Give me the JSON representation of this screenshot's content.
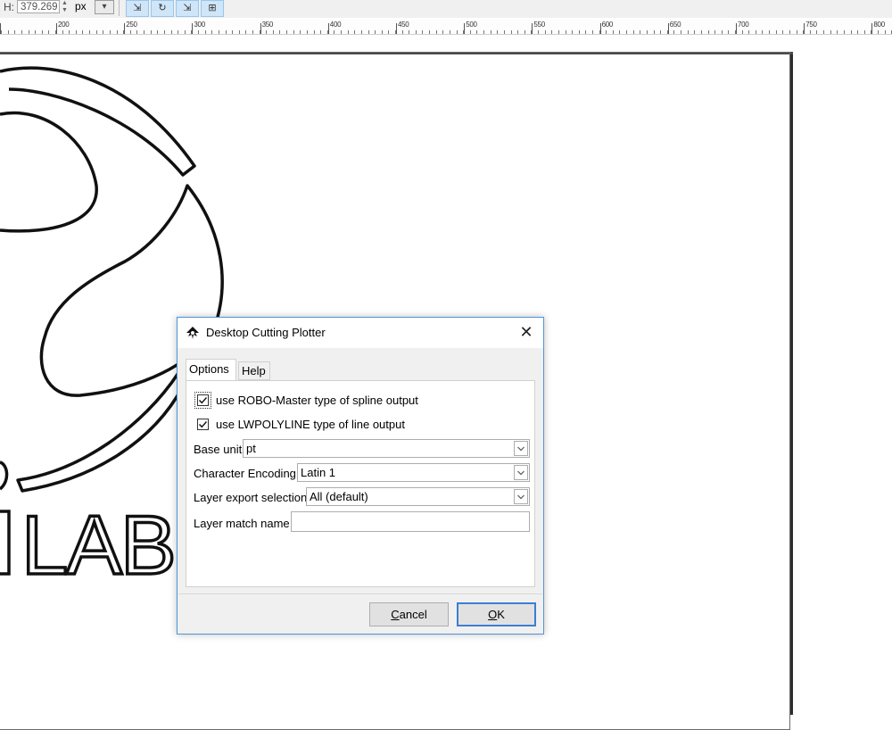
{
  "toolbar": {
    "height_label": "H:",
    "height_value": "379.269",
    "unit": "px",
    "buttons": [
      {
        "name": "transform-scale-icon"
      },
      {
        "name": "transform-rotate-icon"
      },
      {
        "name": "transform-gradient-icon"
      },
      {
        "name": "transform-pattern-icon"
      }
    ]
  },
  "ruler": {
    "labels": [
      "200",
      "250",
      "300",
      "350",
      "400",
      "450",
      "500",
      "550",
      "600",
      "650",
      "700",
      "750",
      "800"
    ]
  },
  "canvas": {
    "logo_text": "LAB"
  },
  "dialog": {
    "title": "Desktop Cutting Plotter",
    "close_symbol": "✕",
    "tabs": {
      "options": "Options",
      "help": "Help"
    },
    "options": {
      "robo_master_label": "use ROBO-Master type of spline output",
      "robo_master_checked": true,
      "lwpolyline_label": "use LWPOLYLINE type of line output",
      "lwpolyline_checked": true,
      "base_unit_label": "Base unit",
      "base_unit_value": "pt",
      "encoding_label": "Character Encoding",
      "encoding_value": "Latin 1",
      "layer_export_label": "Layer export selection",
      "layer_export_value": "All (default)",
      "layer_match_label": "Layer match name",
      "layer_match_value": ""
    },
    "buttons": {
      "cancel_first": "C",
      "cancel_rest": "ancel",
      "ok_first": "O",
      "ok_rest": "K"
    }
  }
}
